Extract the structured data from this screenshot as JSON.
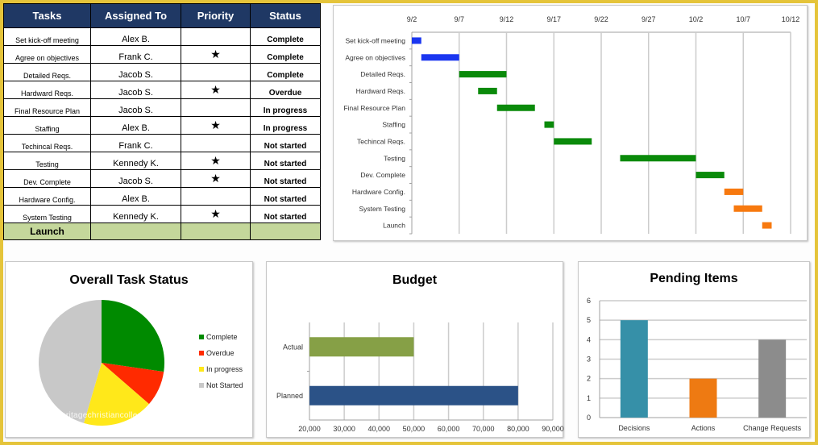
{
  "task_table": {
    "headers": [
      "Tasks",
      "Assigned To",
      "Priority",
      "Status"
    ],
    "rows": [
      {
        "task": "Set kick-off meeting",
        "assigned": "Alex B.",
        "priority": "",
        "status": "Complete",
        "status_key": "complete"
      },
      {
        "task": "Agree on objectives",
        "assigned": "Frank C.",
        "priority": "★",
        "status": "Complete",
        "status_key": "complete"
      },
      {
        "task": "Detailed Reqs.",
        "assigned": "Jacob S.",
        "priority": "",
        "status": "Complete",
        "status_key": "complete"
      },
      {
        "task": "Hardward Reqs.",
        "assigned": "Jacob S.",
        "priority": "★",
        "status": "Overdue",
        "status_key": "overdue"
      },
      {
        "task": "Final Resource Plan",
        "assigned": "Jacob S.",
        "priority": "",
        "status": "In progress",
        "status_key": "progress"
      },
      {
        "task": "Staffing",
        "assigned": "Alex B.",
        "priority": "★",
        "status": "In progress",
        "status_key": "progress"
      },
      {
        "task": "Techincal Reqs.",
        "assigned": "Frank C.",
        "priority": "",
        "status": "Not started",
        "status_key": "notstarted"
      },
      {
        "task": "Testing",
        "assigned": "Kennedy K.",
        "priority": "★",
        "status": "Not started",
        "status_key": "notstarted"
      },
      {
        "task": "Dev. Complete",
        "assigned": "Jacob S.",
        "priority": "★",
        "status": "Not started",
        "status_key": "notstarted"
      },
      {
        "task": "Hardware Config.",
        "assigned": "Alex B.",
        "priority": "",
        "status": "Not started",
        "status_key": "notstarted"
      },
      {
        "task": "System Testing",
        "assigned": "Kennedy K.",
        "priority": "★",
        "status": "Not started",
        "status_key": "notstarted"
      }
    ],
    "launch_row": {
      "task": "Launch",
      "assigned": "",
      "priority": "",
      "status": ""
    }
  },
  "chart_data": [
    {
      "id": "gantt",
      "type": "bar",
      "subtype": "gantt",
      "title": "",
      "x_ticks": [
        "9/2",
        "9/7",
        "9/12",
        "9/17",
        "9/22",
        "9/27",
        "10/2",
        "10/7",
        "10/12"
      ],
      "x_range_days": [
        0,
        40
      ],
      "x_tick_step_days": 5,
      "x_origin": "9/2",
      "grid": true,
      "tasks": [
        {
          "label": "Set kick-off meeting",
          "start_day": 0,
          "end_day": 1,
          "color": "#1a36f0"
        },
        {
          "label": "Agree on objectives",
          "start_day": 1,
          "end_day": 5,
          "color": "#1a36f0"
        },
        {
          "label": "Detailed Reqs.",
          "start_day": 5,
          "end_day": 10,
          "color": "#0a8a0a"
        },
        {
          "label": "Hardward Reqs.",
          "start_day": 7,
          "end_day": 9,
          "color": "#0a8a0a"
        },
        {
          "label": "Final Resource Plan",
          "start_day": 9,
          "end_day": 13,
          "color": "#0a8a0a"
        },
        {
          "label": "Staffing",
          "start_day": 14,
          "end_day": 15,
          "color": "#0a8a0a"
        },
        {
          "label": "Techincal Reqs.",
          "start_day": 15,
          "end_day": 19,
          "color": "#0a8a0a"
        },
        {
          "label": "Testing",
          "start_day": 22,
          "end_day": 30,
          "color": "#0a8a0a"
        },
        {
          "label": "Dev. Complete",
          "start_day": 30,
          "end_day": 33,
          "color": "#0a8a0a"
        },
        {
          "label": "Hardware Config.",
          "start_day": 33,
          "end_day": 35,
          "color": "#f7790f"
        },
        {
          "label": "System Testing",
          "start_day": 34,
          "end_day": 37,
          "color": "#f7790f"
        },
        {
          "label": "Launch",
          "start_day": 37,
          "end_day": 38,
          "color": "#f7790f"
        }
      ]
    },
    {
      "id": "pie",
      "type": "pie",
      "title": "Overall Task Status",
      "legend_position": "right",
      "slices": [
        {
          "label": "Complete",
          "value": 3,
          "color": "#008a00"
        },
        {
          "label": "Overdue",
          "value": 1,
          "color": "#ff2a00"
        },
        {
          "label": "In progress",
          "value": 2,
          "color": "#ffe81a"
        },
        {
          "label": "Not Started",
          "value": 5,
          "color": "#c8c8c8"
        }
      ]
    },
    {
      "id": "budget",
      "type": "bar",
      "orientation": "horizontal",
      "title": "Budget",
      "categories": [
        "Actual",
        "Planned"
      ],
      "values": [
        50000,
        80000
      ],
      "colors": [
        "#86a046",
        "#2b5287"
      ],
      "xlim": [
        20000,
        90000
      ],
      "x_ticks": [
        "20,000",
        "30,000",
        "40,000",
        "50,000",
        "60,000",
        "70,000",
        "80,000",
        "90,000"
      ],
      "grid": true,
      "xlabel": "",
      "ylabel": ""
    },
    {
      "id": "pending",
      "type": "bar",
      "title": "Pending Items",
      "categories": [
        "Decisions",
        "Actions",
        "Change Requests"
      ],
      "values": [
        5,
        2,
        4
      ],
      "colors": [
        "#3690a8",
        "#ee7a12",
        "#8c8c8c"
      ],
      "ylim": [
        0,
        6
      ],
      "y_ticks": [
        "0",
        "1",
        "2",
        "3",
        "4",
        "5",
        "6"
      ],
      "grid": true,
      "xlabel": "",
      "ylabel": ""
    }
  ],
  "watermark": "www.heritagechristiancollege.com"
}
